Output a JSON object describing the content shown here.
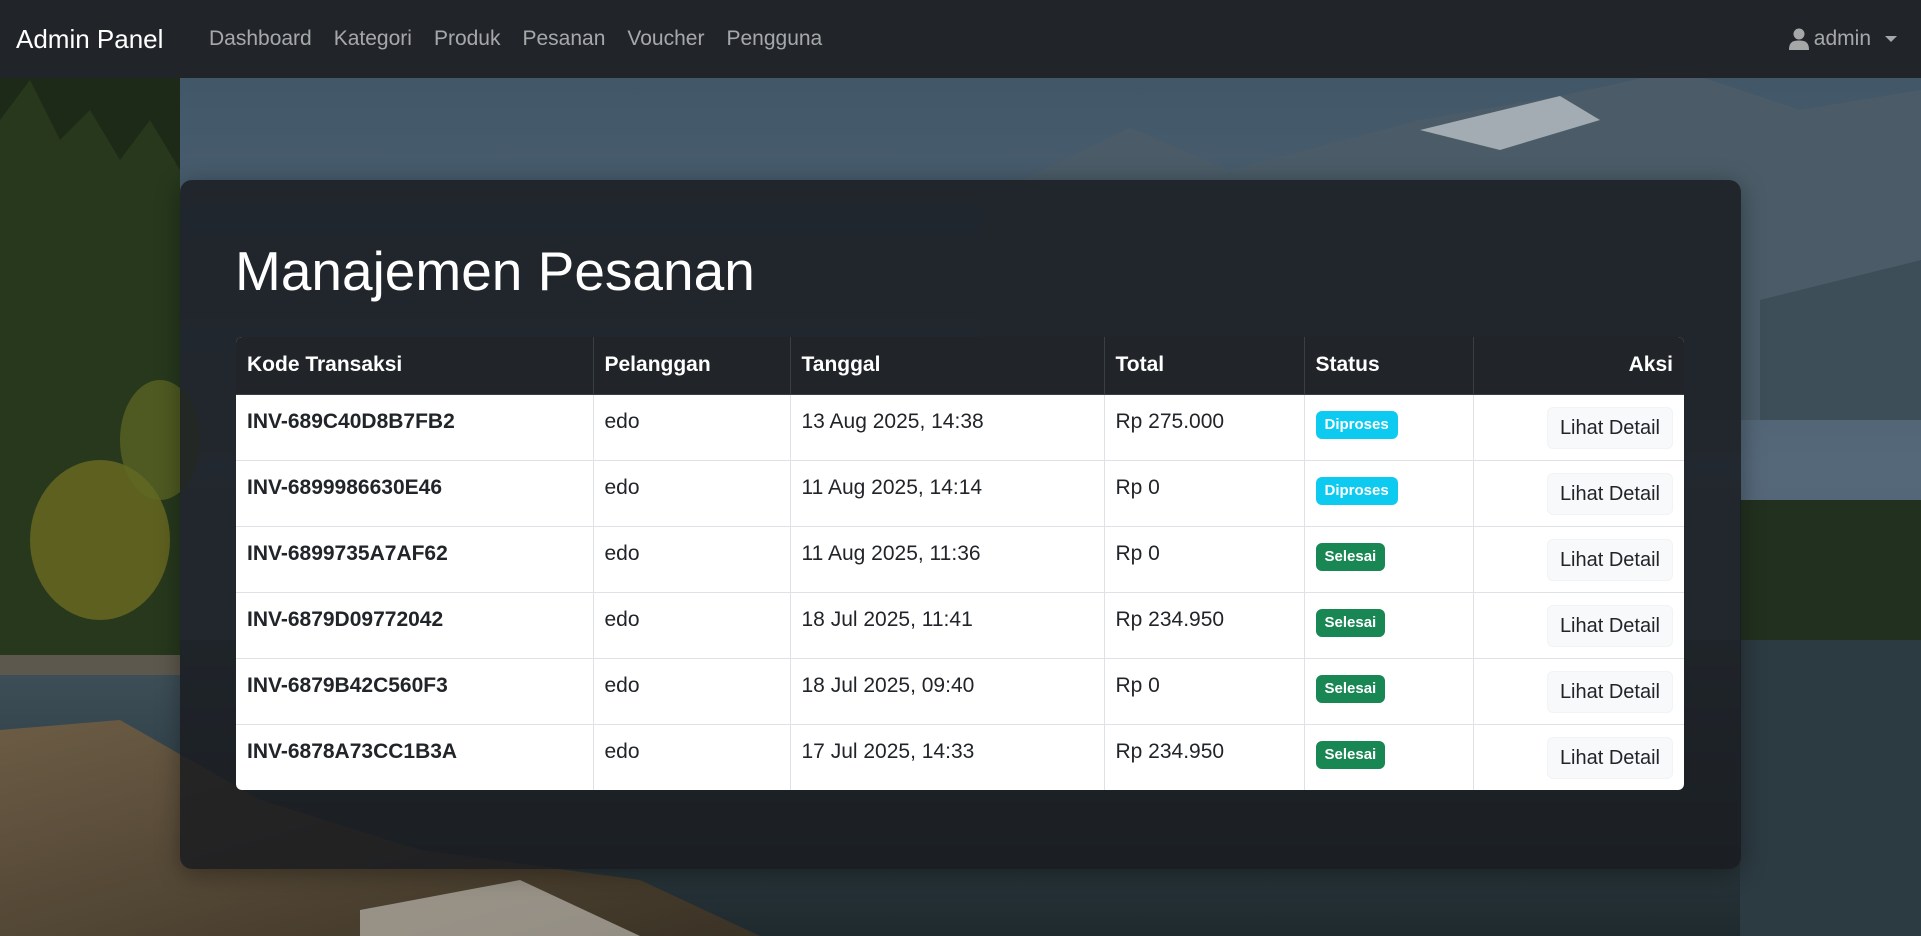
{
  "navbar": {
    "brand": "Admin Panel",
    "links": [
      {
        "label": "Dashboard"
      },
      {
        "label": "Kategori"
      },
      {
        "label": "Produk"
      },
      {
        "label": "Pesanan"
      },
      {
        "label": "Voucher"
      },
      {
        "label": "Pengguna"
      }
    ],
    "user": {
      "name": "admin",
      "icon": "user-icon"
    }
  },
  "page": {
    "title": "Manajemen Pesanan"
  },
  "table": {
    "headers": {
      "code": "Kode Transaksi",
      "customer": "Pelanggan",
      "date": "Tanggal",
      "total": "Total",
      "status": "Status",
      "action": "Aksi"
    },
    "rows": [
      {
        "code": "INV-689C40D8B7FB2",
        "customer": "edo",
        "date": "13 Aug 2025, 14:38",
        "total": "Rp 275.000",
        "status": "Diproses",
        "action": "Lihat Detail"
      },
      {
        "code": "INV-6899986630E46",
        "customer": "edo",
        "date": "11 Aug 2025, 14:14",
        "total": "Rp 0",
        "status": "Diproses",
        "action": "Lihat Detail"
      },
      {
        "code": "INV-6899735A7AF62",
        "customer": "edo",
        "date": "11 Aug 2025, 11:36",
        "total": "Rp 0",
        "status": "Selesai",
        "action": "Lihat Detail"
      },
      {
        "code": "INV-6879D09772042",
        "customer": "edo",
        "date": "18 Jul 2025, 11:41",
        "total": "Rp 234.950",
        "status": "Selesai",
        "action": "Lihat Detail"
      },
      {
        "code": "INV-6879B42C560F3",
        "customer": "edo",
        "date": "18 Jul 2025, 09:40",
        "total": "Rp 0",
        "status": "Selesai",
        "action": "Lihat Detail"
      },
      {
        "code": "INV-6878A73CC1B3A",
        "customer": "edo",
        "date": "17 Jul 2025, 14:33",
        "total": "Rp 234.950",
        "status": "Selesai",
        "action": "Lihat Detail"
      }
    ]
  },
  "colors": {
    "navbar": "#212529",
    "badge_diproses": "#0dcaf0",
    "badge_selesai": "#198754"
  }
}
